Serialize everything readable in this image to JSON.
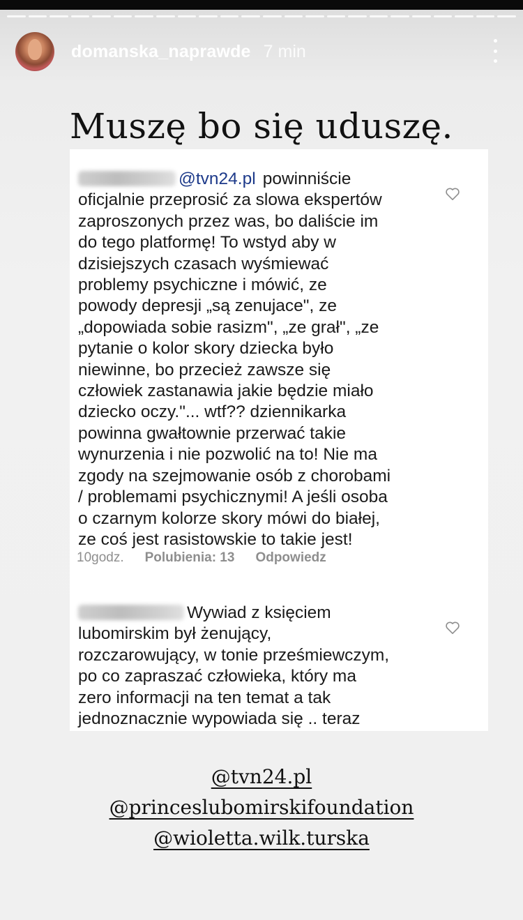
{
  "story": {
    "progress_segments": 24,
    "username": "domanska_naprawde",
    "time": "7 min",
    "menu_icon": "more-vertical-icon"
  },
  "headline": "Muszę bo się uduszę.",
  "comments": [
    {
      "mention": "@tvn24.pl",
      "first_line_rest": "powinniście",
      "lines": [
        "oficjalnie przeprosić za slowa ekspertów",
        "zaproszonych przez was, bo daliście im",
        "do tego platformę! To wstyd aby w",
        "dzisiejszych czasach wyśmiewać",
        "problemy psychiczne i mówić, ze",
        "powody depresji „są zenujace\", ze",
        "„dopowiada sobie rasizm\", „ze grał\", „ze",
        "pytanie o kolor skory dziecka było",
        "niewinne, bo przecież zawsze się",
        "człowiek zastanawia jakie będzie miało",
        "dziecko oczy.\"... wtf?? dziennikarka",
        "powinna gwałtownie przerwać takie",
        "wynurzenia i nie pozwolić na to! Nie ma",
        "zgody na szejmowanie osób z chorobami",
        "/ problemami psychicznymi! A jeśli osoba",
        "o czarnym kolorze skory mówi do białej,",
        "ze coś jest rasistowskie to takie jest!"
      ],
      "meta": {
        "time": "10godz.",
        "likes": "Polubienia: 13",
        "reply": "Odpowiedz"
      }
    },
    {
      "first_line_rest": "Wywiad z księciem",
      "lines": [
        "lubomirskim był żenujący,",
        "rozczarowujący, w tonie prześmiewczym,",
        "po co zapraszać człowieka, który ma",
        "zero informacji na ten temat a tak",
        "jednoznacznie wypowiada się .. teraz"
      ]
    }
  ],
  "tags": [
    "@tvn24.pl",
    "@princeslubomirskifoundation",
    "@wioletta.wilk.turska"
  ],
  "colors": {
    "mention": "#1d3a8a",
    "meta": "#8e8e8e"
  }
}
